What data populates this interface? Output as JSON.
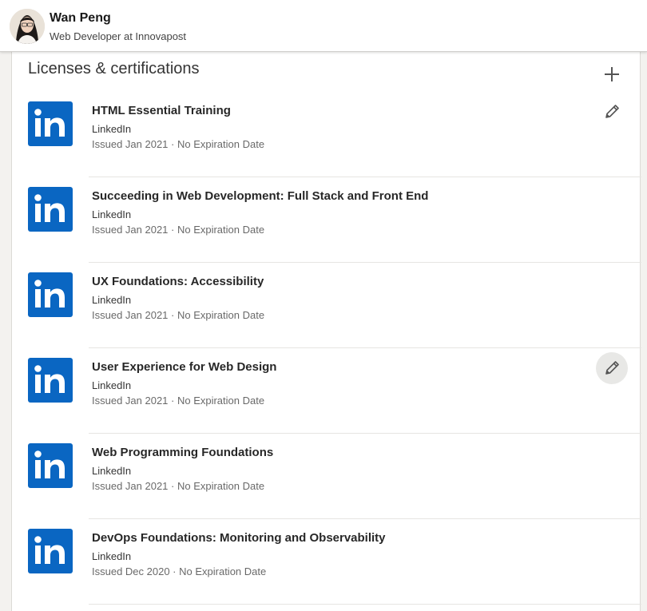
{
  "profile": {
    "name": "Wan Peng",
    "headline": "Web Developer at Innovapost"
  },
  "section": {
    "title": "Licenses & certifications",
    "add_icon": "plus-icon",
    "edit_icon": "pencil-icon"
  },
  "certifications": [
    {
      "title": "HTML Essential Training",
      "issuer": "LinkedIn",
      "dates": "Issued Jan 2021 · No Expiration Date",
      "edit_visible": true,
      "edit_hover": false
    },
    {
      "title": "Succeeding in Web Development: Full Stack and Front End",
      "issuer": "LinkedIn",
      "dates": "Issued Jan 2021 · No Expiration Date",
      "edit_visible": false,
      "edit_hover": false
    },
    {
      "title": "UX Foundations: Accessibility",
      "issuer": "LinkedIn",
      "dates": "Issued Jan 2021 · No Expiration Date",
      "edit_visible": false,
      "edit_hover": false
    },
    {
      "title": "User Experience for Web Design",
      "issuer": "LinkedIn",
      "dates": "Issued Jan 2021 · No Expiration Date",
      "edit_visible": true,
      "edit_hover": true
    },
    {
      "title": "Web Programming Foundations",
      "issuer": "LinkedIn",
      "dates": "Issued Jan 2021 · No Expiration Date",
      "edit_visible": false,
      "edit_hover": false
    },
    {
      "title": "DevOps Foundations: Monitoring and Observability",
      "issuer": "LinkedIn",
      "dates": "Issued Dec 2020 · No Expiration Date",
      "edit_visible": false,
      "edit_hover": false
    }
  ],
  "colors": {
    "brand": "#0a66c2",
    "page_bg": "#f3f2ef"
  }
}
